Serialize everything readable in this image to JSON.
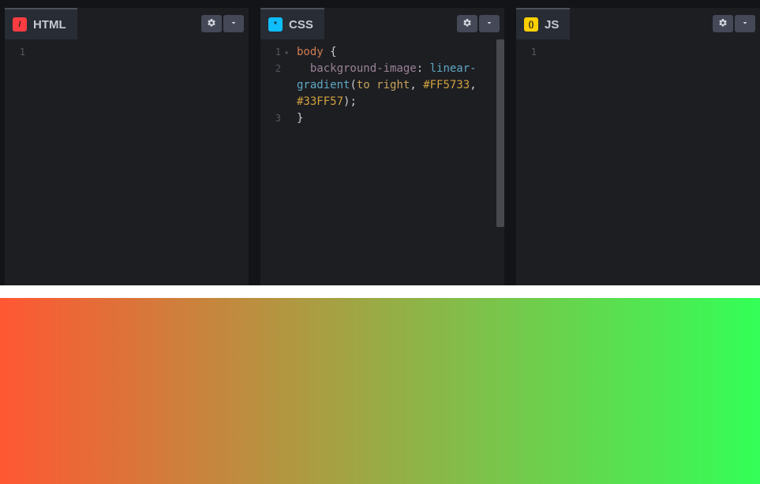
{
  "panels": {
    "html": {
      "label": "HTML",
      "icon_glyph": "/",
      "lines": [
        "1"
      ],
      "code_rows": [
        ""
      ]
    },
    "css": {
      "label": "CSS",
      "icon_glyph": "*",
      "lines": [
        "1",
        "2",
        "3"
      ],
      "code": {
        "selector": "body",
        "open_brace": "{",
        "property": "background-image",
        "colon": ":",
        "fn_part1": "linear-",
        "fn_part2": "gradient",
        "paren_open": "(",
        "direction": "to right",
        "comma1": ",",
        "hex1": "#FF5733",
        "comma2": ",",
        "hex2": "#33FF57",
        "paren_close_semi": ");",
        "close_brace": "}"
      }
    },
    "js": {
      "label": "JS",
      "icon_glyph": "()",
      "lines": [
        "1"
      ],
      "code_rows": [
        ""
      ]
    }
  },
  "output": {
    "gradient_from": "#FF5733",
    "gradient_to": "#33FF57"
  }
}
